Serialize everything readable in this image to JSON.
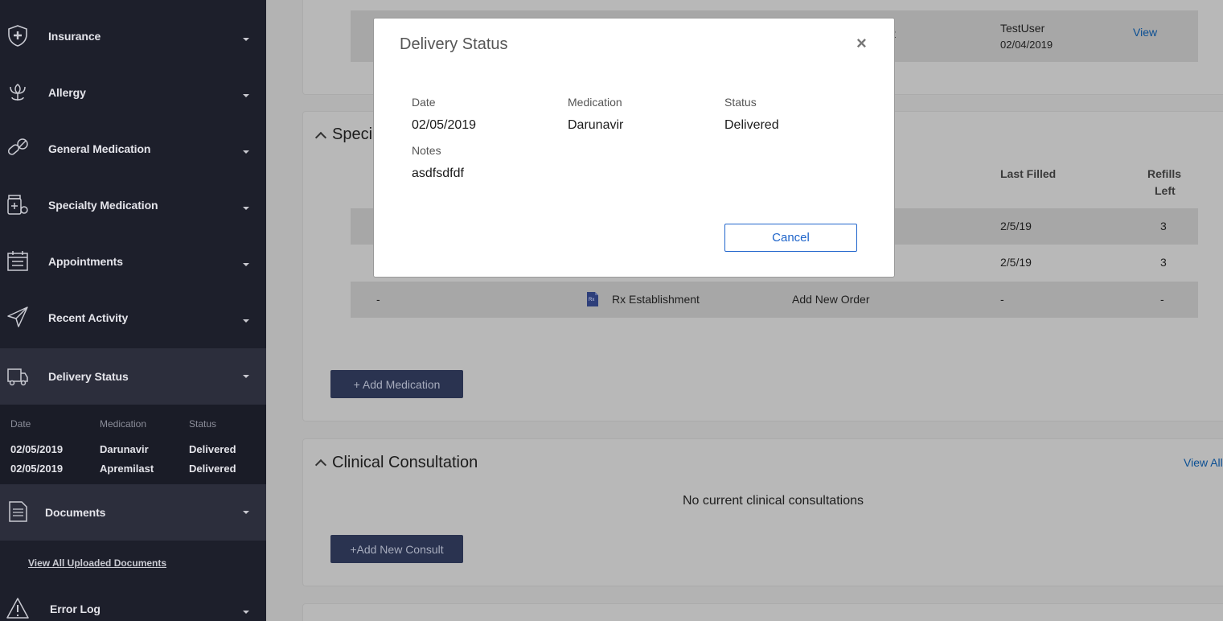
{
  "sidebar": {
    "items": [
      {
        "label": "Insurance",
        "icon": "shield-plus-icon"
      },
      {
        "label": "Allergy",
        "icon": "flower-icon"
      },
      {
        "label": "General Medication",
        "icon": "pills-icon"
      },
      {
        "label": "Specialty Medication",
        "icon": "medicine-bottle-icon"
      },
      {
        "label": "Appointments",
        "icon": "calendar-icon"
      },
      {
        "label": "Recent Activity",
        "icon": "paper-plane-icon"
      },
      {
        "label": "Delivery Status",
        "icon": "truck-icon"
      },
      {
        "label": "Documents",
        "icon": "document-icon"
      },
      {
        "label": "Error Log",
        "icon": "warning-icon"
      }
    ],
    "delivery": {
      "headers": {
        "date": "Date",
        "medication": "Medication",
        "status": "Status"
      },
      "rows": [
        {
          "date": "02/05/2019",
          "medication": "Darunavir",
          "status": "Delivered"
        },
        {
          "date": "02/05/2019",
          "medication": "Apremilast",
          "status": "Delivered"
        }
      ]
    },
    "docs_link": "View All Uploaded Documents"
  },
  "main": {
    "top_row": {
      "partial": "t",
      "user": "TestUser",
      "date": "02/04/2019",
      "view": "View"
    },
    "specialty": {
      "title_partial": "Speci",
      "col_last_filled": "Last Filled",
      "col_refills_1": "Refills",
      "col_refills_2": "Left",
      "rows": [
        {
          "last_filled": "2/5/19",
          "refills": "3"
        },
        {
          "last_filled": "2/5/19",
          "refills": "3"
        }
      ],
      "rx_row": {
        "c1": "-",
        "name": "Rx Establishment",
        "action": "Add New Order",
        "last_filled": "-",
        "refills": "-"
      },
      "add_button": "+ Add Medication"
    },
    "clinical": {
      "title": "Clinical Consultation",
      "view_all": "View All",
      "empty": "No current clinical consultations",
      "add_button": "+Add New Consult"
    }
  },
  "modal": {
    "title": "Delivery Status",
    "close": "×",
    "date_label": "Date",
    "date_value": "02/05/2019",
    "medication_label": "Medication",
    "medication_value": "Darunavir",
    "status_label": "Status",
    "status_value": "Delivered",
    "notes_label": "Notes",
    "notes_value": "asdfsdfdf",
    "cancel": "Cancel"
  }
}
